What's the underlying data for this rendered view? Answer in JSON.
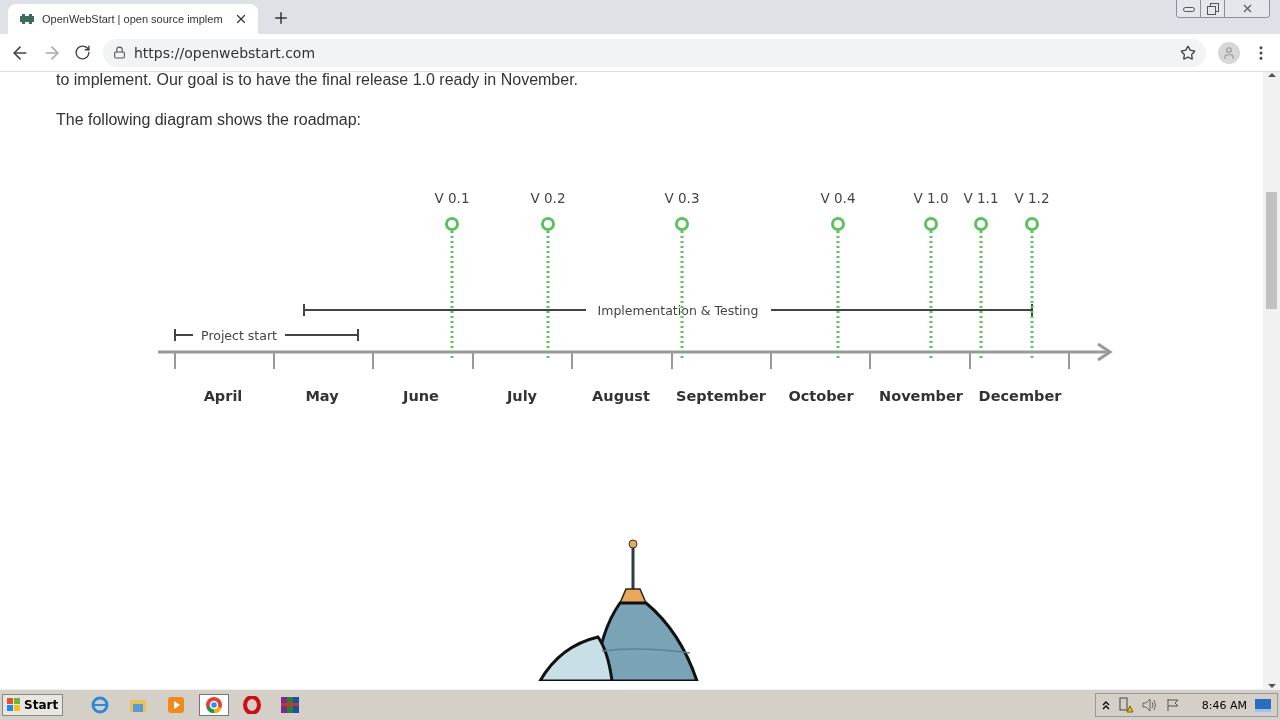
{
  "browser": {
    "tab_title": "OpenWebStart | open source implem",
    "url": "https://openwebstart.com"
  },
  "page": {
    "paragraphs": [
      "to implement. Our goal is to have the final release 1.0 ready in November.",
      "The following diagram shows the roadmap:"
    ],
    "roadmap": {
      "versions": [
        "V 0.1",
        "V 0.2",
        "V 0.3",
        "V 0.4",
        "V 1.0",
        "V 1.1",
        "V 1.2"
      ],
      "phases": [
        "Implementation & Testing",
        "Project start"
      ],
      "months": [
        "April",
        "May",
        "June",
        "July",
        "August",
        "September",
        "October",
        "November",
        "December"
      ]
    }
  },
  "taskbar": {
    "start": "Start",
    "clock": "8:46 AM"
  }
}
